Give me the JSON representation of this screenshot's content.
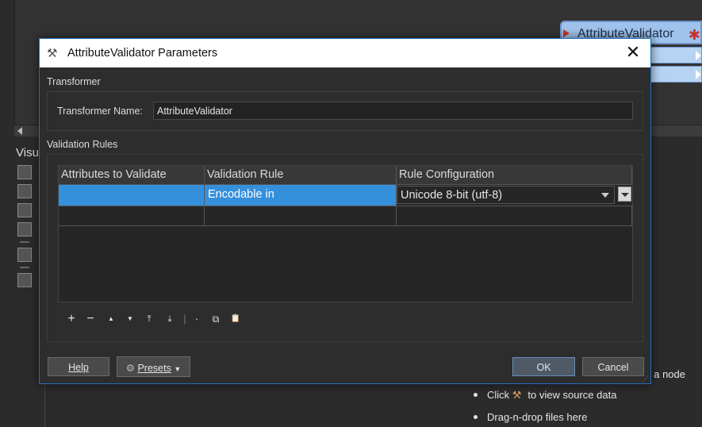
{
  "background": {
    "node_title": "AttributeValidator",
    "visual_label": "Visu",
    "help_items": [
      {
        "text": "t a node"
      },
      {
        "prefix": "Click",
        "suffix": "to view source data"
      },
      {
        "text": "Drag-n-drop files here"
      }
    ]
  },
  "dialog": {
    "title": "AttributeValidator Parameters",
    "close_glyph": "✕",
    "transformer_section": "Transformer",
    "transformer_name_label": "Transformer Name:",
    "transformer_name_value": "AttributeValidator",
    "rules_section": "Validation Rules",
    "table": {
      "columns": [
        "Attributes to Validate",
        "Validation Rule",
        "Rule Configuration"
      ],
      "rows": [
        {
          "attribute": "",
          "rule": "Encodable in",
          "config": "Unicode 8-bit (utf-8)"
        }
      ]
    },
    "toolbar_glyphs": {
      "add": "+",
      "remove": "−",
      "up": "▲",
      "down": "▼",
      "top": "⤒",
      "bottom": "⤓",
      "sep": "|",
      "dot": "·",
      "copy": "⧉",
      "paste": "📋"
    },
    "buttons": {
      "help": "Help",
      "presets": "Presets",
      "ok": "OK",
      "cancel": "Cancel"
    }
  }
}
